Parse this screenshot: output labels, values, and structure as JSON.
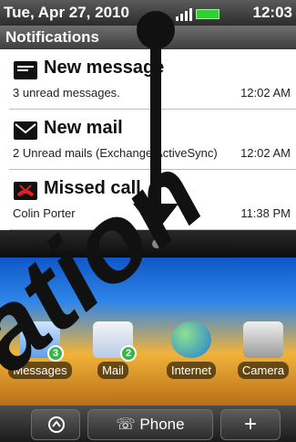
{
  "status": {
    "date": "Tue, Apr 27, 2010",
    "time": "12:03"
  },
  "notifications": {
    "header": "Notifications",
    "items": [
      {
        "title": "New message",
        "subtitle": "3 unread messages.",
        "time": "12:02 AM",
        "icon": "sms-icon"
      },
      {
        "title": "New mail",
        "subtitle": "2 Unread mails (Exchange ActiveSync)",
        "time": "12:02 AM",
        "icon": "mail-icon"
      },
      {
        "title": "Missed call",
        "subtitle": "Colin Porter",
        "time": "11:38 PM",
        "icon": "missed-call-icon"
      }
    ]
  },
  "apps": [
    {
      "label": "Messages",
      "badge": "3",
      "icon": "messages-icon"
    },
    {
      "label": "Mail",
      "badge": "2",
      "icon": "mail-app-icon"
    },
    {
      "label": "Internet",
      "badge": "",
      "icon": "globe-icon"
    },
    {
      "label": "Camera",
      "badge": "",
      "icon": "camera-icon"
    }
  ],
  "dock": {
    "phone_label": "Phone",
    "add_label": "+"
  },
  "watermark": "cation",
  "colors": {
    "accent": "#2fd12f",
    "badge": "#39b54a"
  }
}
